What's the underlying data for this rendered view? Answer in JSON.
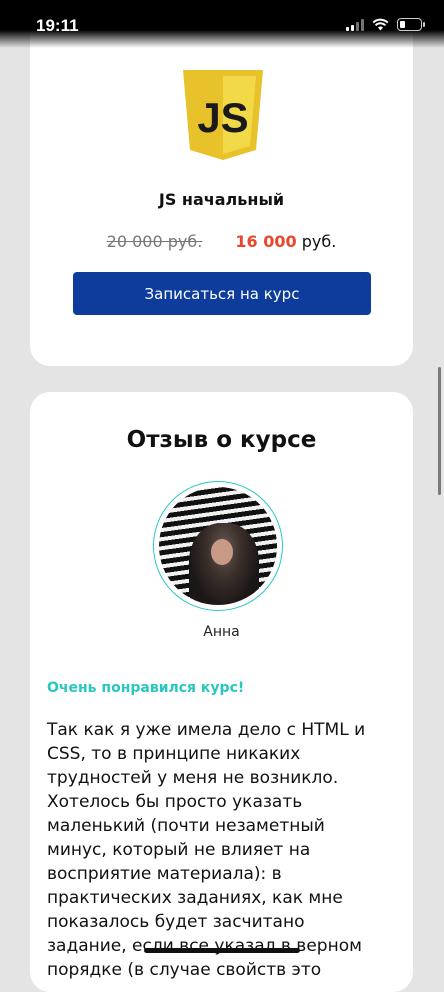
{
  "status": {
    "time": "19:11"
  },
  "course": {
    "logo_text": "JS",
    "title": "JS начальный",
    "price_old": "20 000 руб.",
    "price_new": "16 000",
    "price_currency": "руб.",
    "enroll_label": "Записаться на курс"
  },
  "review": {
    "section_title": "Отзыв о курсе",
    "reviewer_name": "Анна",
    "headline": "Очень понравился курс!",
    "text": "Так как я уже имела дело с HTML и CSS, то в принципе никаких трудностей у меня не возникло. Хотелось бы просто указать маленький (почти незаметный минус, который не влияет на восприятие материала): в практических заданиях, как мне показалось будет засчитано задание, если все указал в верном порядке (в случае свойств это"
  },
  "colors": {
    "accent_blue": "#0d3c9c",
    "price_red": "#e8472b",
    "teal": "#2ac7c0",
    "js_yellow": "#f0db4f"
  }
}
